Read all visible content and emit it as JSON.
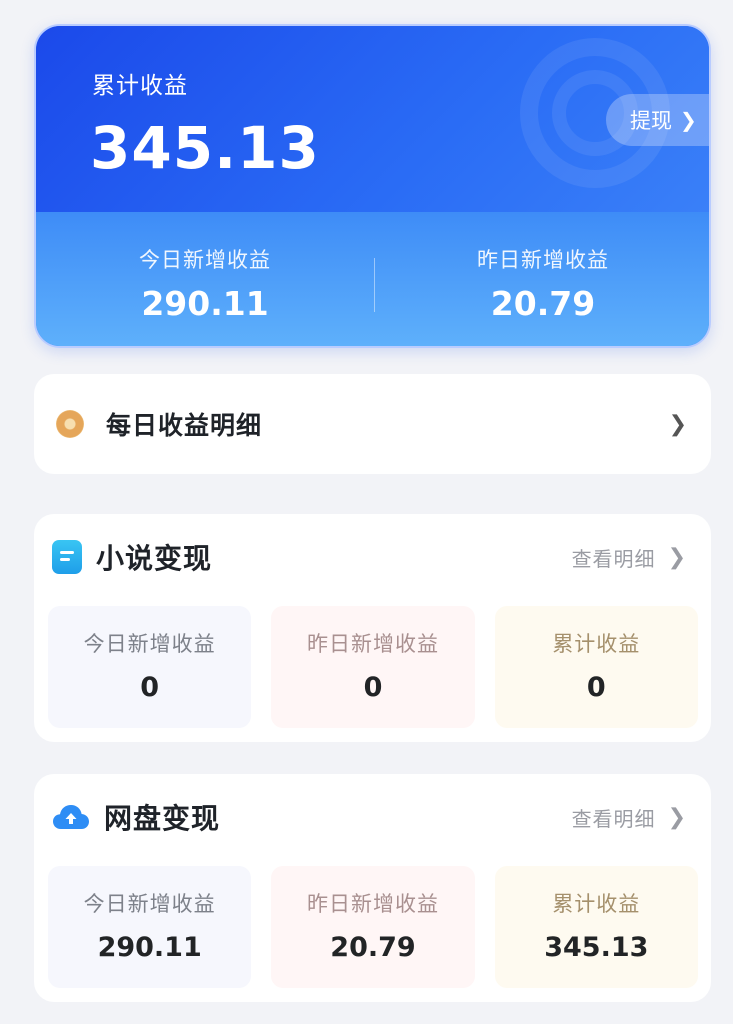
{
  "hero": {
    "total_label": "累计收益",
    "total_value": "345.13",
    "withdraw_label": "提现",
    "today_label": "今日新增收益",
    "today_value": "290.11",
    "yesterday_label": "昨日新增收益",
    "yesterday_value": "20.79"
  },
  "daily": {
    "label": "每日收益明细"
  },
  "novel": {
    "title": "小说变现",
    "link": "查看明细",
    "stats": [
      {
        "label": "今日新增收益",
        "value": "0"
      },
      {
        "label": "昨日新增收益",
        "value": "0"
      },
      {
        "label": "累计收益",
        "value": "0"
      }
    ]
  },
  "netdisk": {
    "title": "网盘变现",
    "link": "查看明细",
    "stats": [
      {
        "label": "今日新增收益",
        "value": "290.11"
      },
      {
        "label": "昨日新增收益",
        "value": "20.79"
      },
      {
        "label": "累计收益",
        "value": "345.13"
      }
    ]
  },
  "colors": {
    "accent_blue": "#1e5cf1",
    "light_blue": "#5fb1fb",
    "coin_gold": "#e5a65a",
    "book_blue": "#1f9ee9",
    "cloud_blue": "#2e8df5"
  },
  "icons": {
    "withdraw_chevron": "chevron-right-icon",
    "daily_icon": "coin-icon",
    "novel_icon": "book-icon",
    "netdisk_icon": "cloud-upload-icon"
  }
}
